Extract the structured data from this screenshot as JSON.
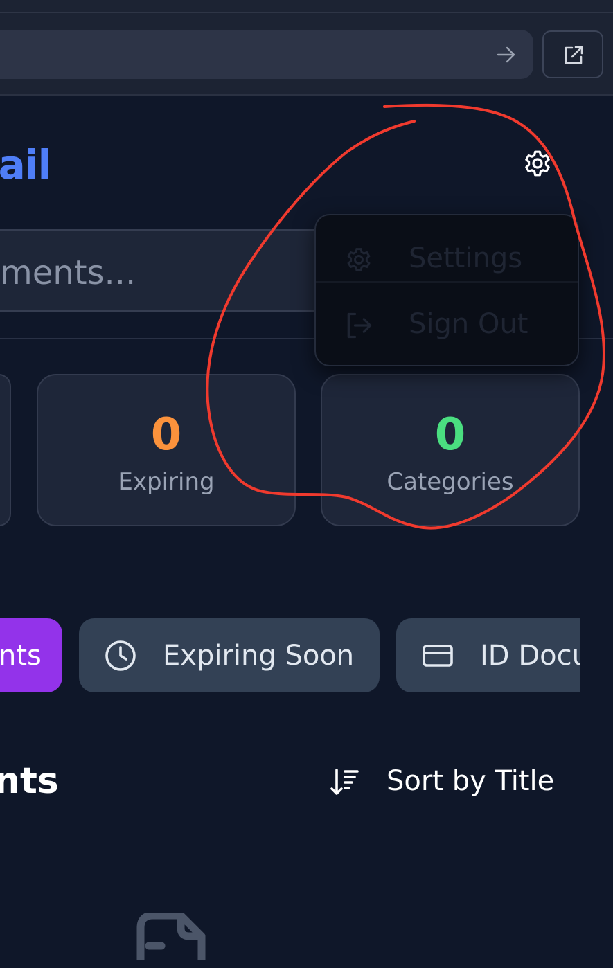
{
  "browser": {
    "forward_icon": "arrow-right-icon",
    "open_external_icon": "external-link-icon"
  },
  "header": {
    "brand_visible": "rail",
    "settings_icon": "gear-icon"
  },
  "search": {
    "placeholder_visible": "ments..."
  },
  "stats": [
    {
      "value": "0",
      "label": "Expiring",
      "color": "#fb923c"
    },
    {
      "value": "0",
      "label": "Categories",
      "color": "#4ade80"
    }
  ],
  "dropdown": {
    "items": [
      {
        "label": "Settings",
        "icon": "gear-icon"
      },
      {
        "label": "Sign Out",
        "icon": "sign-out-icon"
      }
    ]
  },
  "filters": {
    "all_visible": "nts",
    "expiring": {
      "label": "Expiring Soon",
      "icon": "clock-icon"
    },
    "id_docs": {
      "label": "ID Docu",
      "icon": "id-card-icon"
    }
  },
  "section": {
    "title_visible": "nts",
    "sort_label": "Sort by Title",
    "sort_icon": "sort-descending-icon"
  },
  "empty_state": {
    "icon": "document-icon"
  },
  "colors": {
    "background": "#0f1729",
    "brand": "#4f7ef7",
    "active_chip": "#9333ea",
    "annotation": "#f03a2e"
  }
}
